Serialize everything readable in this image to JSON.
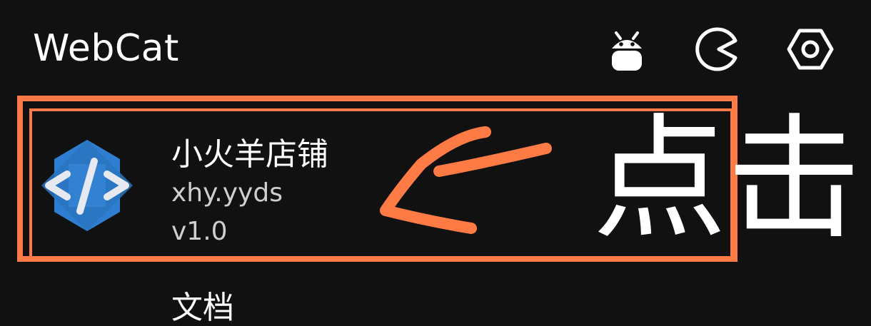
{
  "header": {
    "title": "WebCat",
    "icons": [
      "android-icon",
      "pacman-icon",
      "settings-icon"
    ]
  },
  "apps": [
    {
      "name": "小火羊店铺",
      "package": "xhy.yyds",
      "version": "v1.0"
    }
  ],
  "annotation": {
    "label": "点击",
    "accent_color": "#ff7b45"
  },
  "next_item": {
    "label": "文档"
  },
  "colors": {
    "background": "#111111",
    "logo_blue": "#2e7fd1"
  }
}
